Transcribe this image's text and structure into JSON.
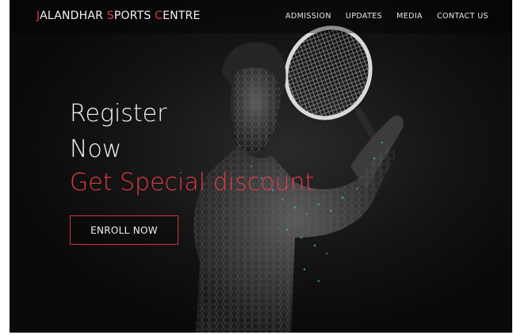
{
  "brand": {
    "first_letter_1": "J",
    "rest_1": "ALANDHAR ",
    "first_letter_2": "S",
    "rest_2": "PORTS ",
    "first_letter_3": "C",
    "rest_3": "ENTRE"
  },
  "nav": {
    "items": [
      "ADMISSION",
      "UPDATES",
      "MEDIA",
      "CONTACT US"
    ]
  },
  "hero": {
    "title_line1": "Register",
    "title_line2": "Now",
    "subtitle": "Get Special discount",
    "button_label": "ENROLL NOW"
  },
  "colors": {
    "accent": "#e03a45",
    "background": "#0d0d0d",
    "text": "#f4f4f4"
  },
  "icons": {
    "hero_image": "tennis-player-image"
  }
}
